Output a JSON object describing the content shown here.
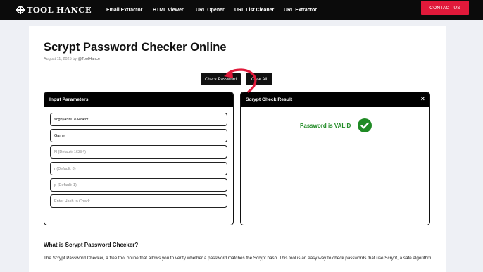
{
  "header": {
    "logo": "TOOL HANCE",
    "nav": [
      "Email Extractor",
      "HTML Viewer",
      "URL Opener",
      "URL List Cleaner",
      "URL Extractor"
    ],
    "contact_label": "CONTACT US"
  },
  "page": {
    "title": "Scrypt Password Checker Online",
    "date": "August 11, 2025",
    "by": "by",
    "author": "@ToolHance"
  },
  "actions": {
    "check_label": "Check Password",
    "clear_label": "Clear All"
  },
  "input_panel": {
    "title": "Input Parameters",
    "fields": [
      {
        "value": "scgby45te1e34r4tcr",
        "placeholder": ""
      },
      {
        "value": "Game",
        "placeholder": ""
      },
      {
        "value": "",
        "placeholder": "N (Default: 16384)"
      },
      {
        "value": "",
        "placeholder": "r (Default: 8)"
      },
      {
        "value": "",
        "placeholder": "p (Default: 1)"
      },
      {
        "value": "",
        "placeholder": "Enter Hash to Check..."
      }
    ]
  },
  "result_panel": {
    "title": "Scrypt Check Result",
    "close": "×",
    "message": "Password is VALID"
  },
  "article": {
    "heading": "What is Scrypt Password Checker?",
    "paragraph": "The Scrypt Password Checker, a free tool online that allows you to verify whether a password matches the Scrypt hash. This tool is an easy way to check passwords that use Scrypt, a safe algorithm."
  },
  "colors": {
    "accent": "#e0193a",
    "success": "#1f8a24",
    "dark": "#0b0b0b"
  },
  "icons": {
    "check": "check-circle-icon",
    "close": "close-icon",
    "pointer_arrow": "curved-arrow-icon"
  }
}
